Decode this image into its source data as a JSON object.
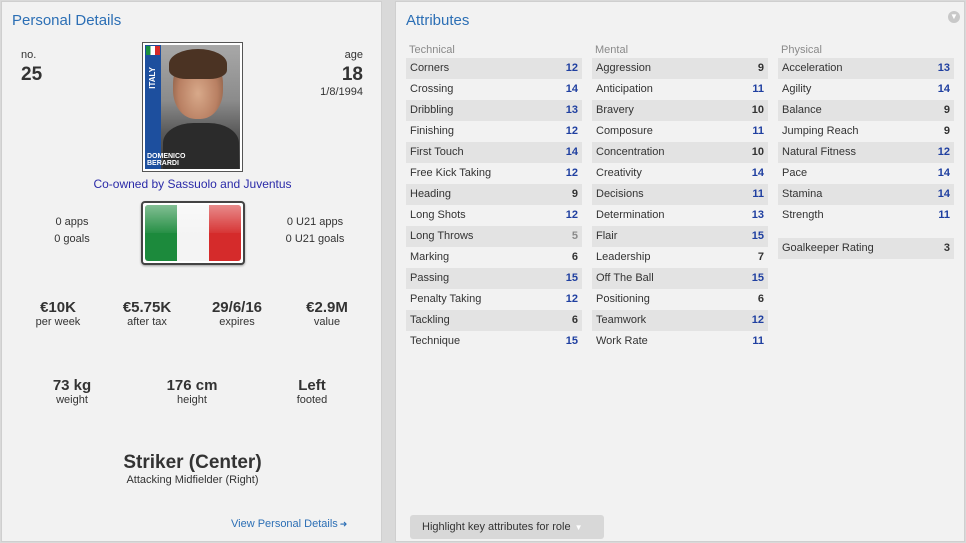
{
  "personal": {
    "title": "Personal Details",
    "no_label": "no.",
    "no_value": "25",
    "age_label": "age",
    "age_value": "18",
    "dob": "1/8/1994",
    "photo_country": "ITALY",
    "photo_name_1": "DOMENICO",
    "photo_name_2": "BERARDI",
    "coowned": "Co-owned by Sassuolo and Juventus",
    "apps": "0 apps",
    "goals": "0 goals",
    "u21_apps": "0 U21 apps",
    "u21_goals": "0 U21 goals",
    "money": [
      {
        "value": "€10K",
        "label": "per week"
      },
      {
        "value": "€5.75K",
        "label": "after tax"
      },
      {
        "value": "29/6/16",
        "label": "expires"
      },
      {
        "value": "€2.9M",
        "label": "value"
      }
    ],
    "physical": [
      {
        "value": "73 kg",
        "label": "weight"
      },
      {
        "value": "176 cm",
        "label": "height"
      },
      {
        "value": "Left",
        "label": "footed"
      }
    ],
    "position": "Striker (Center)",
    "position_sub": "Attacking Midfielder (Right)",
    "view_link": "View Personal Details"
  },
  "attributes": {
    "title": "Attributes",
    "highlight_button": "Highlight key attributes for role",
    "technical": {
      "heading": "Technical",
      "items": [
        {
          "name": "Corners",
          "value": "12"
        },
        {
          "name": "Crossing",
          "value": "14"
        },
        {
          "name": "Dribbling",
          "value": "13"
        },
        {
          "name": "Finishing",
          "value": "12"
        },
        {
          "name": "First Touch",
          "value": "14"
        },
        {
          "name": "Free Kick Taking",
          "value": "12"
        },
        {
          "name": "Heading",
          "value": "9"
        },
        {
          "name": "Long Shots",
          "value": "12"
        },
        {
          "name": "Long Throws",
          "value": "5"
        },
        {
          "name": "Marking",
          "value": "6"
        },
        {
          "name": "Passing",
          "value": "15"
        },
        {
          "name": "Penalty Taking",
          "value": "12"
        },
        {
          "name": "Tackling",
          "value": "6"
        },
        {
          "name": "Technique",
          "value": "15"
        }
      ]
    },
    "mental": {
      "heading": "Mental",
      "items": [
        {
          "name": "Aggression",
          "value": "9"
        },
        {
          "name": "Anticipation",
          "value": "11"
        },
        {
          "name": "Bravery",
          "value": "10"
        },
        {
          "name": "Composure",
          "value": "11"
        },
        {
          "name": "Concentration",
          "value": "10"
        },
        {
          "name": "Creativity",
          "value": "14"
        },
        {
          "name": "Decisions",
          "value": "11"
        },
        {
          "name": "Determination",
          "value": "13"
        },
        {
          "name": "Flair",
          "value": "15"
        },
        {
          "name": "Leadership",
          "value": "7"
        },
        {
          "name": "Off The Ball",
          "value": "15"
        },
        {
          "name": "Positioning",
          "value": "6"
        },
        {
          "name": "Teamwork",
          "value": "12"
        },
        {
          "name": "Work Rate",
          "value": "11"
        }
      ]
    },
    "physical": {
      "heading": "Physical",
      "items": [
        {
          "name": "Acceleration",
          "value": "13"
        },
        {
          "name": "Agility",
          "value": "14"
        },
        {
          "name": "Balance",
          "value": "9"
        },
        {
          "name": "Jumping Reach",
          "value": "9"
        },
        {
          "name": "Natural Fitness",
          "value": "12"
        },
        {
          "name": "Pace",
          "value": "14"
        },
        {
          "name": "Stamina",
          "value": "14"
        },
        {
          "name": "Strength",
          "value": "11"
        }
      ],
      "gk_label": "Goalkeeper Rating",
      "gk_value": "3"
    }
  }
}
